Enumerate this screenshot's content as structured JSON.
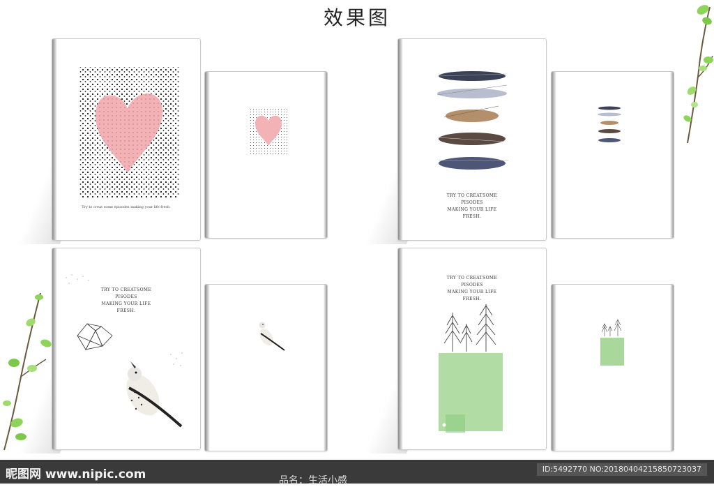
{
  "page": {
    "title": "效果图"
  },
  "cards": {
    "heart": {
      "caption": "Try to creat some episodes making your life fresh."
    },
    "feathers": {
      "lines": [
        "TRY TO CREATSOME",
        "PISODES",
        "MAKING YOUR LIFE",
        "FRESH."
      ]
    },
    "bird": {
      "lines": [
        "TRY TO CREATSOME",
        "PISODES",
        "MAKING YOUR LIFE",
        "FRESH."
      ]
    },
    "trees": {
      "lines": [
        "TRY TO CREATSOME",
        "PISODES",
        "MAKING YOUR LIFE",
        "FRESH."
      ]
    }
  },
  "footer": {
    "logo": "昵图网 www.nipic.com",
    "id_text": "ID:5492770 NO:20180404215850723037",
    "product_name": "品名：生活小感"
  },
  "colors": {
    "heart": "#f2b2b6",
    "green": "#a8d89a",
    "footer_bg": "#3a3a3a"
  }
}
